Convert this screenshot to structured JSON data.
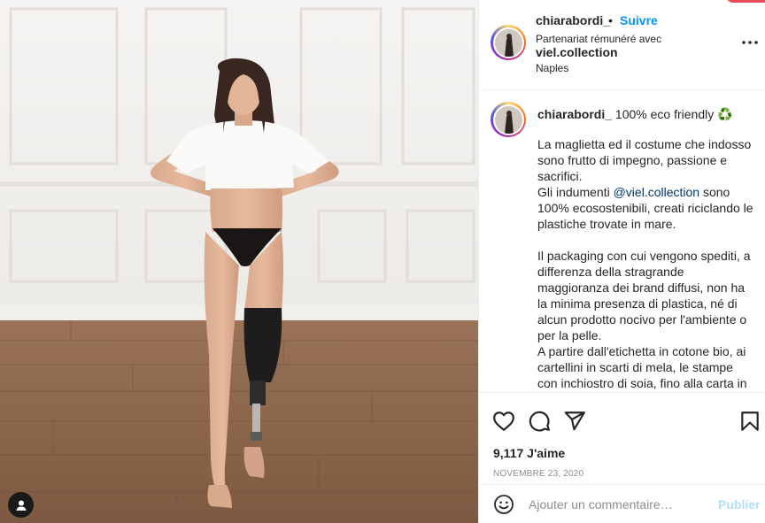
{
  "post": {
    "username": "chiarabordi_",
    "separator": "•",
    "follow_label": "Suivre",
    "partnership_label": "Partenariat rémunéré avec",
    "partner_brand": "viel.collection",
    "location": "Naples",
    "more_icon": "more-horizontal-icon"
  },
  "caption": {
    "username": "chiarabordi_",
    "headline": "100% eco friendly ♻️",
    "lines": [
      "La maglietta ed il costume che indosso sono frutto di impegno, passione e sacrifici.",
      "Gli indumenti ",
      "@viel.collection",
      " sono 100% ecosostenibili, creati riciclando le plastiche trovate in mare.",
      "Il packaging con cui vengono spediti, a differenza della stragrande maggioranza dei brand diffusi, non ha la minima presenza di plastica, né di alcun prodotto nocivo per l'ambiente o per la pelle.",
      "A partire dall'etichetta in cotone bio, ai cartellini in scarti di mela, le stampe con inchiostro di soia, fino alla carta in"
    ]
  },
  "actions": {
    "like_icon": "heart-icon",
    "comment_icon": "comment-icon",
    "share_icon": "share-icon",
    "save_icon": "bookmark-icon"
  },
  "stats": {
    "likes": "9,117 J'aime",
    "date": "NOVEMBRE 23, 2020"
  },
  "comment_box": {
    "placeholder": "Ajouter un commentaire…",
    "publish_label": "Publier",
    "emoji_icon": "smiley-icon"
  },
  "colors": {
    "accent": "#0095f6",
    "publish_disabled": "#b2dffc",
    "mention": "#00376b",
    "notification": "#ed4956"
  }
}
